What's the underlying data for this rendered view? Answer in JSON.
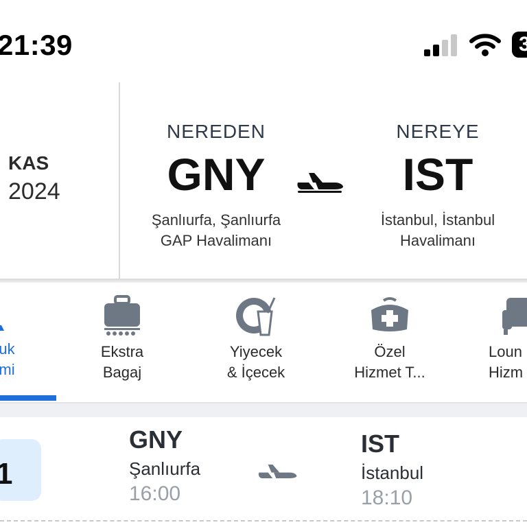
{
  "status_bar": {
    "time": "21:39",
    "battery": "3"
  },
  "header": {
    "month": "KAS",
    "year": "2024",
    "from": {
      "label": "NEREDEN",
      "code": "GNY",
      "city_line1": "Şanlıurfa, Şanlıurfa",
      "city_line2": "GAP Havalimanı"
    },
    "to": {
      "label": "NEREYE",
      "code": "IST",
      "city_line1": "İstanbul, İstanbul",
      "city_line2": "Havalimanı"
    }
  },
  "services": [
    {
      "line1": "uk",
      "line2": "mi",
      "icon": "seat-icon",
      "active": true
    },
    {
      "line1": "Ekstra",
      "line2": "Bagaj",
      "icon": "baggage-icon"
    },
    {
      "line1": "Yiyecek",
      "line2": "& İçecek",
      "icon": "food-drink-icon"
    },
    {
      "line1": "Özel",
      "line2": "Hizmet T...",
      "icon": "medical-kit-icon"
    },
    {
      "line1": "Loun",
      "line2": "Hizm",
      "icon": "lounge-sofa-icon"
    }
  ],
  "flight": {
    "seat_badge": "1",
    "origin": {
      "code": "GNY",
      "city": "Şanlıurfa",
      "time": "16:00"
    },
    "destination": {
      "code": "IST",
      "city": "İstanbul",
      "time": "18:10"
    }
  },
  "colors": {
    "accent": "#1e6fd9",
    "badge_bg": "#dfeefc",
    "time_gray": "#9aa0a8"
  }
}
